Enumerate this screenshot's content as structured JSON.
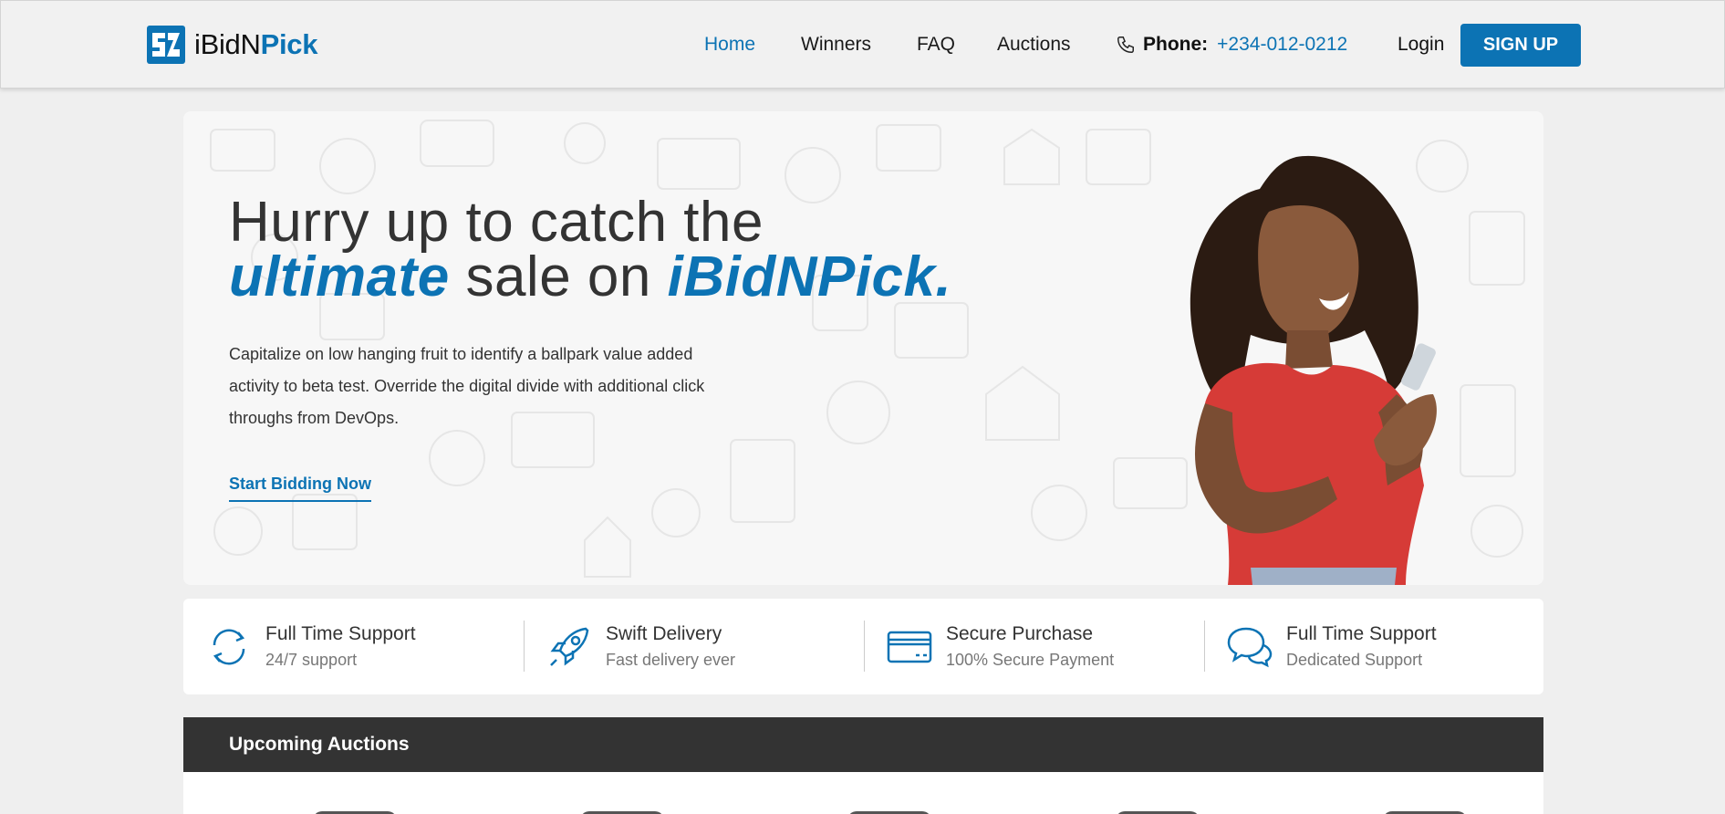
{
  "brand": {
    "name_part1": "iBidN",
    "name_part2": "Pick",
    "color": "#0c73b4"
  },
  "nav": {
    "items": [
      {
        "label": "Home",
        "active": true
      },
      {
        "label": "Winners",
        "active": false
      },
      {
        "label": "FAQ",
        "active": false
      },
      {
        "label": "Auctions",
        "active": false
      }
    ],
    "phone_label": "Phone:",
    "phone_number": "+234-012-0212",
    "login_label": "Login",
    "signup_label": "SIGN UP"
  },
  "hero": {
    "title_line1": "Hurry up to catch the",
    "title_em1": "ultimate",
    "title_mid": " sale on ",
    "title_em2": "iBidNPick.",
    "description": "Capitalize on low hanging fruit to identify a ballpark value added activity to beta test. Override the digital divide with additional click throughs from DevOps.",
    "cta_label": "Start Bidding Now"
  },
  "features": [
    {
      "title": "Full Time Support",
      "subtitle": "24/7 support",
      "icon": "refresh-icon"
    },
    {
      "title": "Swift Delivery",
      "subtitle": "Fast delivery ever",
      "icon": "rocket-icon"
    },
    {
      "title": "Secure Purchase",
      "subtitle": "100% Secure Payment",
      "icon": "credit-card-icon"
    },
    {
      "title": "Full Time Support",
      "subtitle": "Dedicated Support",
      "icon": "chat-bubbles-icon"
    }
  ],
  "upcoming": {
    "title": "Upcoming Auctions"
  },
  "colors": {
    "accent": "#0c73b4",
    "dark_bar": "#333333",
    "hero_bg": "#f7f7f7"
  }
}
